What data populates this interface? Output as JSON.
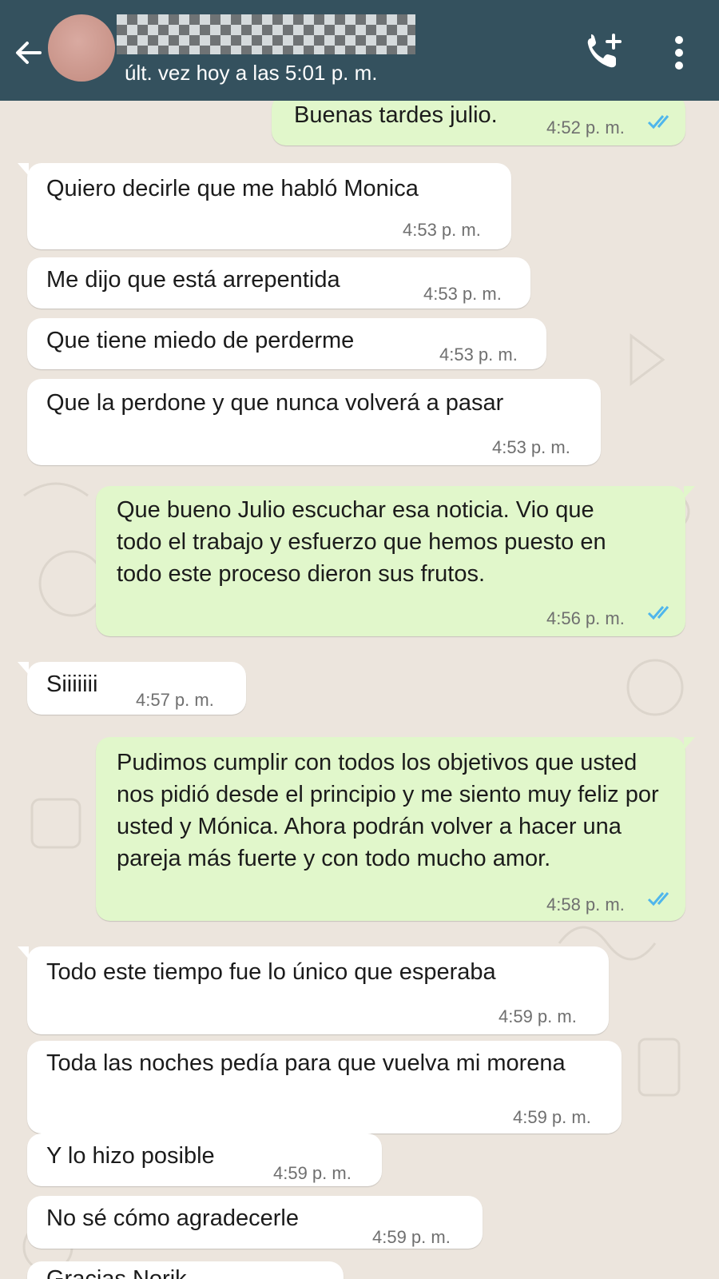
{
  "header": {
    "last_seen": "últ. vez hoy a las 5:01 p. m.",
    "icons": {
      "back": "back-arrow-icon",
      "call": "add-call-icon",
      "menu": "more-vert-icon"
    },
    "colors": {
      "bar": "#34515e",
      "outgoing": "#e1f7cb",
      "incoming": "#ffffff",
      "read_ticks": "#4fb6ec",
      "wallpaper": "#ece5dd"
    }
  },
  "messages": [
    {
      "direction": "out",
      "text": "Buenas tardes julio.",
      "time": "4:52 p. m.",
      "status": "read"
    },
    {
      "direction": "in",
      "text": "Quiero decirle que me habló Monica",
      "time": "4:53 p. m."
    },
    {
      "direction": "in",
      "text": "Me dijo que está arrepentida",
      "time": "4:53 p. m."
    },
    {
      "direction": "in",
      "text": "Que tiene miedo de perderme",
      "time": "4:53 p. m."
    },
    {
      "direction": "in",
      "text": "Que la perdone y que nunca volverá a pasar",
      "time": "4:53 p. m."
    },
    {
      "direction": "out",
      "text": "Que bueno Julio escuchar esa noticia. Vio que todo el trabajo y esfuerzo que hemos puesto en todo este proceso dieron sus frutos.",
      "time": "4:56 p. m.",
      "status": "read"
    },
    {
      "direction": "in",
      "text": "Siiiiiii",
      "time": "4:57 p. m."
    },
    {
      "direction": "out",
      "text": "Pudimos cumplir con todos los objetivos que usted nos pidió desde el principio y me siento muy feliz por usted y Mónica. Ahora podrán volver a hacer una pareja más fuerte y con todo mucho amor.",
      "time": "4:58 p. m.",
      "status": "read"
    },
    {
      "direction": "in",
      "text": "Todo este tiempo fue lo único que esperaba",
      "time": "4:59 p. m."
    },
    {
      "direction": "in",
      "text": "Toda las noches pedía para que vuelva mi morena",
      "time": "4:59 p. m."
    },
    {
      "direction": "in",
      "text": "Y lo hizo posible",
      "time": "4:59 p. m."
    },
    {
      "direction": "in",
      "text": "No sé cómo agradecerle",
      "time": "4:59 p. m."
    },
    {
      "direction": "in",
      "text": "Gracias Norik",
      "time": ""
    }
  ]
}
